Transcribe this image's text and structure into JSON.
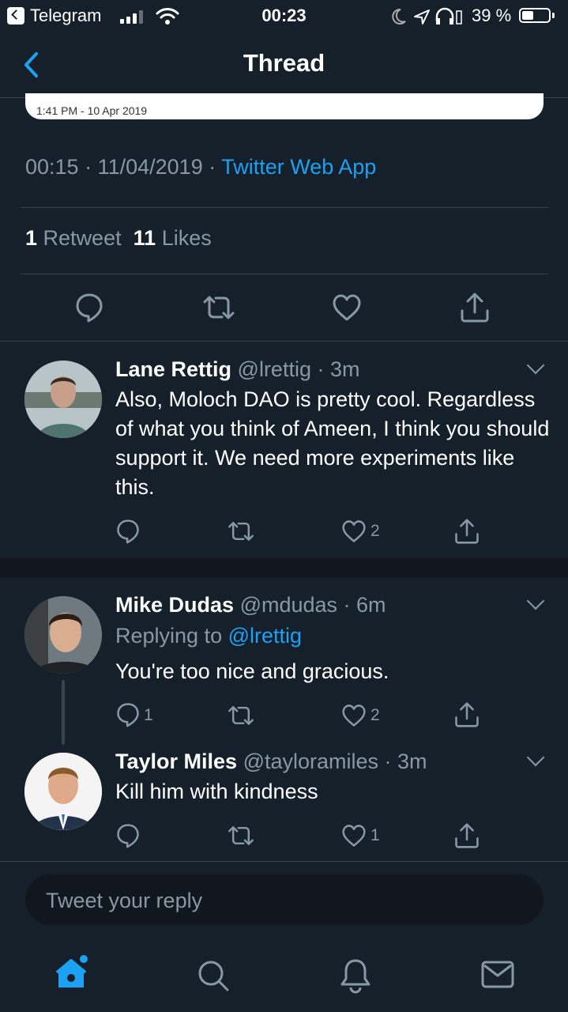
{
  "status_bar": {
    "app": "Telegram",
    "time": "00:23",
    "battery": "39 %",
    "battery_level": 0.39
  },
  "nav": {
    "title": "Thread",
    "back_icon": "chevron-left-icon"
  },
  "embedded_card": {
    "timestamp": "1:41 PM - 10 Apr 2019"
  },
  "main_tweet": {
    "time": "00:15",
    "date": "11/04/2019",
    "source": "Twitter Web App",
    "retweets": "1",
    "retweets_label": "Retweet",
    "likes": "11",
    "likes_label": "Likes"
  },
  "replies": [
    {
      "name": "Lane Rettig",
      "handle": "@lrettig",
      "age": "3m",
      "text": "Also, Moloch DAO is pretty cool. Regardless of what you think of Ameen, I think you should support it. We need more experiments like this.",
      "reply_count": "",
      "like_count": "2"
    },
    {
      "name": "Mike Dudas",
      "handle": "@mdudas",
      "age": "6m",
      "replying_label": "Replying to",
      "replying_to": "@lrettig",
      "text": "You're too nice and gracious.",
      "reply_count": "1",
      "like_count": "2"
    },
    {
      "name": "Taylor Miles",
      "handle": "@tayloramiles",
      "age": "3m",
      "text": "Kill him with kindness",
      "reply_count": "",
      "like_count": "1"
    }
  ],
  "reply_box": {
    "placeholder": "Tweet your reply"
  },
  "tabbar": {
    "items": [
      "home-icon",
      "search-icon",
      "notifications-icon",
      "messages-icon"
    ]
  },
  "colors": {
    "background": "#15202b",
    "accent": "#1da1f2",
    "secondary_text": "#8899a6",
    "divider": "#38444d"
  }
}
